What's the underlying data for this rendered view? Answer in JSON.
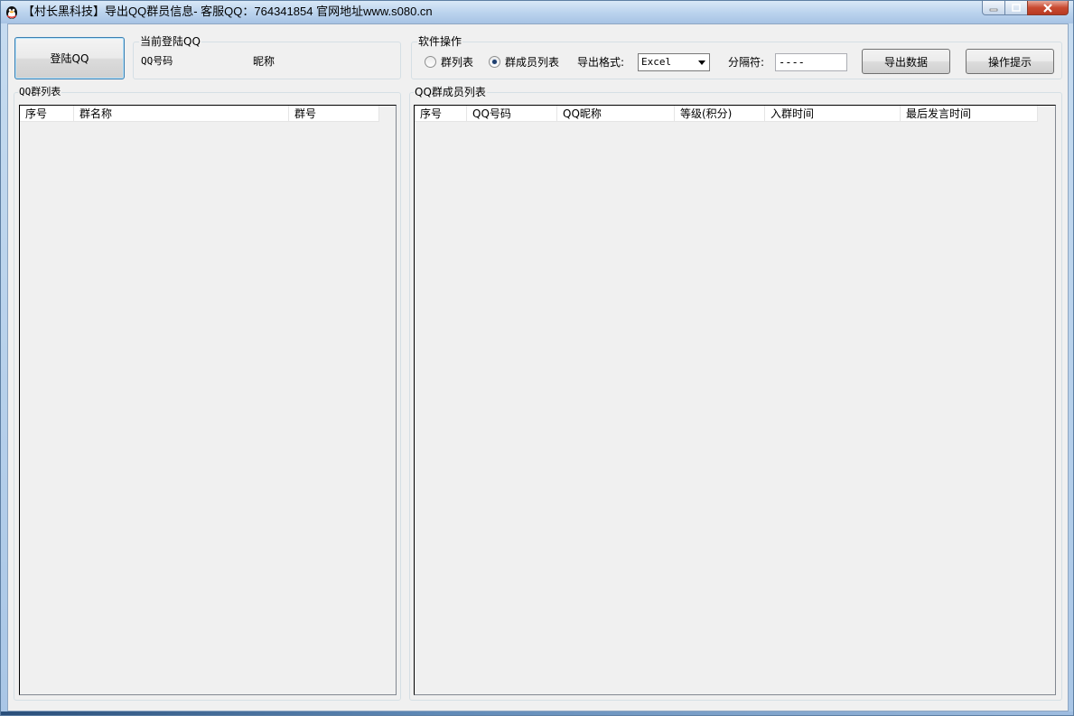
{
  "window": {
    "title": "【村长黑科技】导出QQ群员信息- 客服QQ：764341854   官网地址www.s080.cn",
    "icon": "qq-penguin-icon"
  },
  "login": {
    "button_label": "登陆QQ",
    "group_title": "当前登陆QQ",
    "qq_label": "QQ号码",
    "nickname_label": "昵称"
  },
  "ops": {
    "group_title": "软件操作",
    "radio_group_list": "群列表",
    "radio_member_list": "群成员列表",
    "selected_radio": "member_list",
    "format_label": "导出格式:",
    "format_value": "Excel",
    "separator_label": "分隔符:",
    "separator_value": "----",
    "export_button": "导出数据",
    "help_button": "操作提示"
  },
  "group_list": {
    "title": "QQ群列表",
    "columns": [
      "序号",
      "群名称",
      "群号"
    ]
  },
  "member_list": {
    "title": "QQ群成员列表",
    "columns": [
      "序号",
      "QQ号码",
      "QQ昵称",
      "等级(积分)",
      "入群时间",
      "最后发言时间"
    ]
  }
}
